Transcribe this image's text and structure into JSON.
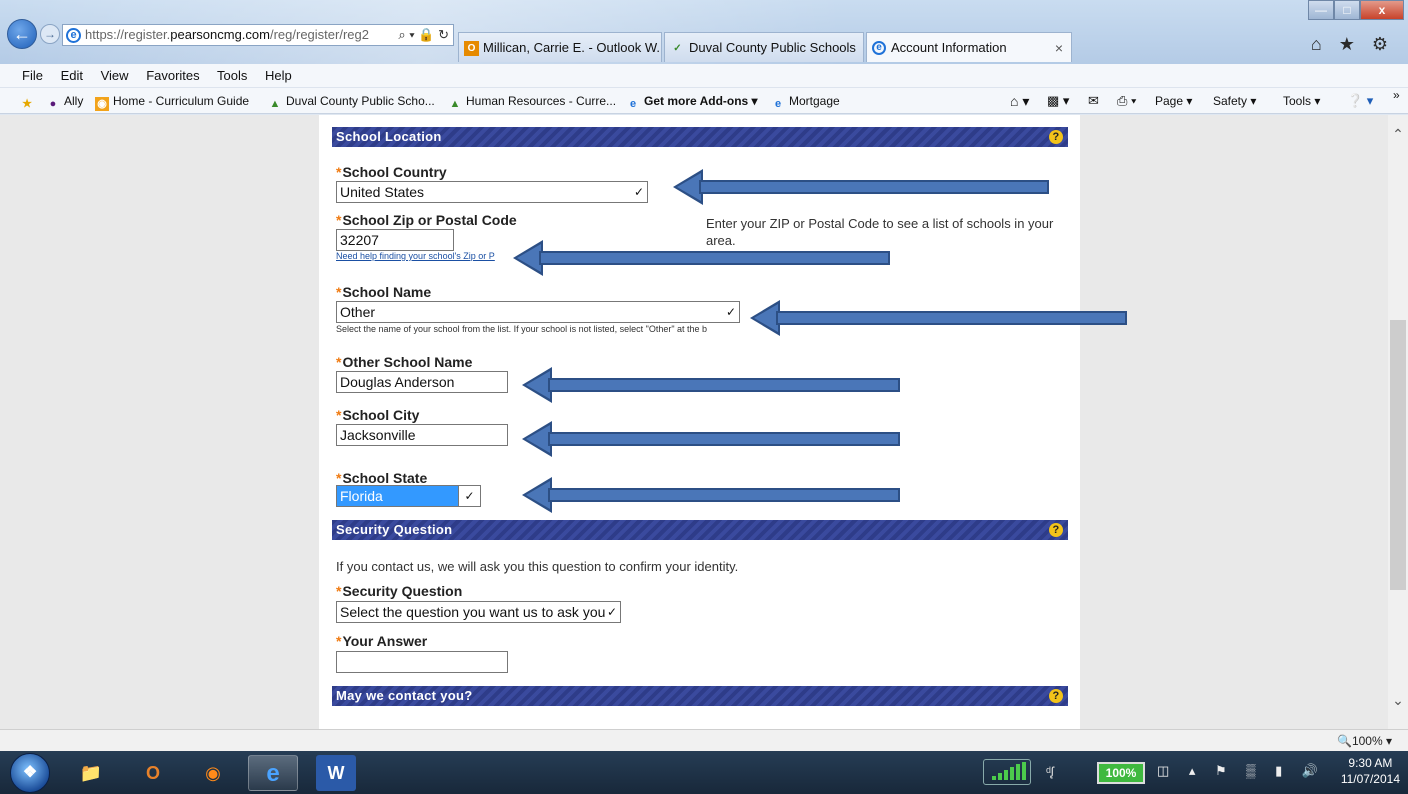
{
  "browser": {
    "url_prefix": "https://register.",
    "url_domain": "pearsoncmg.com",
    "url_path": "/reg/register/reg2",
    "url_tools": "⌕ ▾ 🔒 ↻",
    "tabs": [
      {
        "label": "Millican, Carrie E. - Outlook W...",
        "icon": "outlook-icon"
      },
      {
        "label": "Duval County Public Schools",
        "icon": "checkmark-page-icon"
      },
      {
        "label": "Account Information",
        "icon": "ie-icon"
      }
    ],
    "tab_close": "×",
    "right_icons": "⌂ ★ ⚙"
  },
  "menu": [
    "File",
    "Edit",
    "View",
    "Favorites",
    "Tools",
    "Help"
  ],
  "favorites": [
    {
      "label": "Ally"
    },
    {
      "label": "Home - Curriculum Guide"
    },
    {
      "label": "Duval County Public Scho..."
    },
    {
      "label": "Human Resources - Curre..."
    },
    {
      "label": "Get more Add-ons ▾"
    },
    {
      "label": "Mortgage"
    }
  ],
  "commandbar": {
    "page": "Page ▾",
    "safety": "Safety ▾",
    "tools": "Tools ▾",
    "more": "»"
  },
  "form": {
    "school_location": {
      "title": "School Location",
      "help": "?",
      "country_label": "School Country",
      "country_value": "United States",
      "zip_label": "School Zip or Postal Code",
      "zip_value": "32207",
      "zip_help": "Enter your ZIP or Postal Code to see a list of schools in your area.",
      "zip_link": "Need help finding your school's Zip or P",
      "name_label": "School Name",
      "name_value": "Other",
      "name_hint": "Select the name of your school from the list. If your school is not listed, select \"Other\" at the b",
      "other_name_label": "Other School Name",
      "other_name_value": "Douglas Anderson",
      "city_label": "School City",
      "city_value": "Jacksonville",
      "state_label": "School State",
      "state_value": "Florida"
    },
    "security": {
      "title": "Security Question",
      "help": "?",
      "intro": "If you contact us, we will ask you this question to confirm your identity.",
      "question_label": "Security Question",
      "question_placeholder": "Select the question you want us to ask you",
      "answer_label": "Your Answer",
      "answer_value": ""
    },
    "contact": {
      "title": "May we contact you?",
      "help": "?"
    },
    "required_mark": "*"
  },
  "status": {
    "zoom": "🔍100%  ▾"
  },
  "taskbar": {
    "battery": "100%",
    "time": "9:30 AM",
    "date": "11/07/2014"
  }
}
